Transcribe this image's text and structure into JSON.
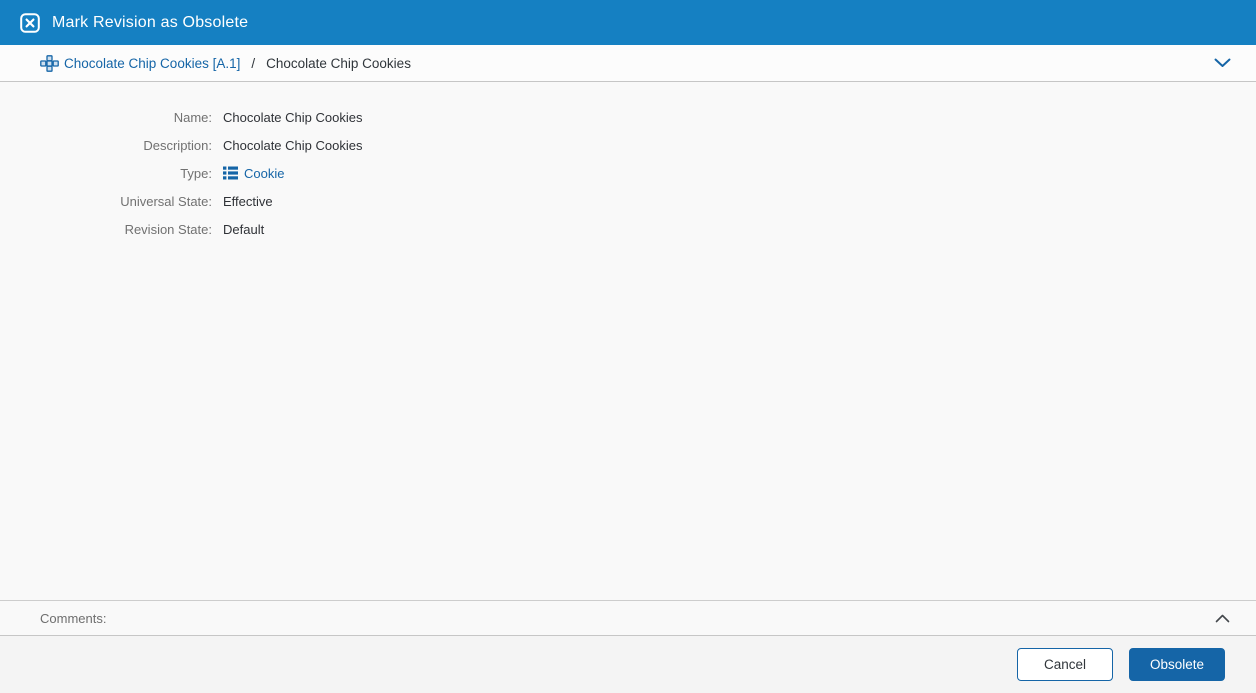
{
  "header": {
    "title": "Mark Revision as Obsolete",
    "icon": "obsolete-x-icon"
  },
  "breadcrumb": {
    "item_icon": "part-icon",
    "link": "Chocolate Chip Cookies [A.1]",
    "separator": "/",
    "current": "Chocolate Chip Cookies",
    "collapse_icon": "chevron-down-icon"
  },
  "form": {
    "fields": [
      {
        "label": "Name:",
        "value": "Chocolate Chip Cookies"
      },
      {
        "label": "Description:",
        "value": "Chocolate Chip Cookies"
      },
      {
        "label": "Type:",
        "value": "Cookie",
        "icon": "list-icon"
      },
      {
        "label": "Universal State:",
        "value": "Effective"
      },
      {
        "label": "Revision State:",
        "value": "Default"
      }
    ]
  },
  "comments": {
    "label": "Comments:",
    "collapse_icon": "chevron-up-icon"
  },
  "footer": {
    "cancel_label": "Cancel",
    "obsolete_label": "Obsolete"
  },
  "colors": {
    "header_bg": "#1580c2",
    "accent_blue": "#1565a7",
    "link_blue": "#1565a7",
    "label_gray": "#717171",
    "value_dark": "#2f3237",
    "divider": "#c6c6c6"
  }
}
